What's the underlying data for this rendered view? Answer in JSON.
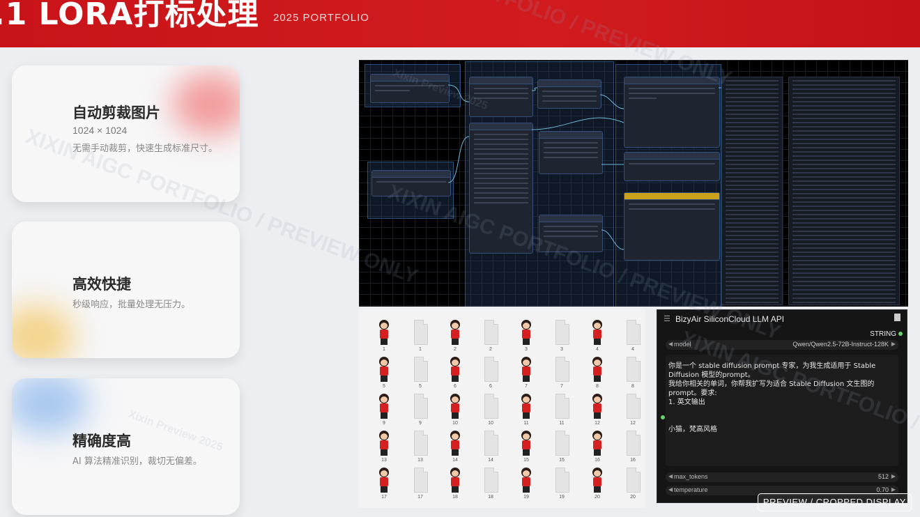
{
  "header": {
    "title": ".1 LORA打标处理",
    "subtitle": "2025 PORTFOLIO"
  },
  "features": [
    {
      "title": "自动剪裁图片",
      "resolution": "1024 × 1024",
      "desc": "无需手动裁剪，快速生成标准尺寸。"
    },
    {
      "title": "高效快捷",
      "desc": "秒级响应，批量处理无压力。"
    },
    {
      "title": "精确度高",
      "desc": "AI 算法精准识别，裁切无偏差。"
    }
  ],
  "thumbnails": {
    "labels": [
      "1",
      "1",
      "2",
      "2",
      "3",
      "3",
      "4",
      "4",
      "5",
      "5",
      "6",
      "6",
      "7",
      "7",
      "8",
      "8",
      "9",
      "9",
      "10",
      "10",
      "11",
      "11",
      "12",
      "12",
      "13",
      "13",
      "14",
      "14",
      "15",
      "15",
      "16",
      "16",
      "17",
      "17",
      "18",
      "18",
      "19",
      "19",
      "20",
      "20"
    ]
  },
  "llm_node": {
    "title": "BizyAir SiliconCloud LLM API",
    "output_type": "STRING",
    "model_label": "model",
    "model_value": "Qwen/Qwen2.5-72B-Instruct-128K",
    "system_prompt": "你是一个 stable diffusion prompt 专家，为我生成适用于 Stable Diffusion 模型的prompt。\n我给你相关的单词，你帮我扩写为适合 Stable Diffusion 文生图的 prompt。要求:\n1. 英文输出",
    "user_prompt": "小猫，梵高风格",
    "max_tokens_label": "max_tokens",
    "max_tokens_value": "512",
    "temperature_label": "temperature",
    "temperature_value": "0.70"
  },
  "watermark": {
    "text_a": "XIXIN AIGC PORTFOLIO / PREVIEW ONLY",
    "text_b": "Xixin Preview 2025",
    "badge": "PREVIEW / CROPPED DISPLAY"
  }
}
